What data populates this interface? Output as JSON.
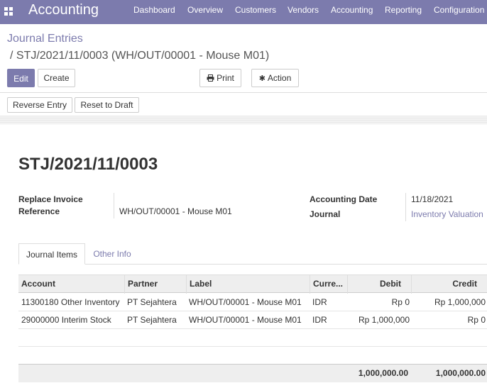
{
  "app": {
    "name": "Accounting"
  },
  "nav": {
    "dashboard": "Dashboard",
    "overview": "Overview",
    "customers": "Customers",
    "vendors": "Vendors",
    "accounting": "Accounting",
    "reporting": "Reporting",
    "configuration": "Configuration"
  },
  "breadcrumb": {
    "parent": "Journal Entries",
    "current": "/ STJ/2021/11/0003 (WH/OUT/00001 - Mouse M01)"
  },
  "toolbar": {
    "edit": "Edit",
    "create": "Create",
    "print": "Print",
    "action": "Action",
    "reverse": "Reverse Entry",
    "reset": "Reset to Draft"
  },
  "record": {
    "title": "STJ/2021/11/0003",
    "replace_invoice_label_1": "Replace Invoice",
    "replace_invoice_label_2": "Reference",
    "reference_value": "WH/OUT/00001 - Mouse M01",
    "accounting_date_label": "Accounting Date",
    "accounting_date_value": "11/18/2021",
    "journal_label": "Journal",
    "journal_value": "Inventory Valuation"
  },
  "tabs": {
    "journal_items": "Journal Items",
    "other_info": "Other Info"
  },
  "table": {
    "headers": {
      "account": "Account",
      "partner": "Partner",
      "label": "Label",
      "currency": "Curre...",
      "debit": "Debit",
      "credit": "Credit"
    },
    "rows": [
      {
        "account": "11300180 Other Inventory",
        "partner": "PT Sejahtera",
        "label": "WH/OUT/00001 - Mouse M01",
        "currency": "IDR",
        "debit": "Rp 0",
        "credit": "Rp 1,000,000"
      },
      {
        "account": "29000000 Interim Stock",
        "partner": "PT Sejahtera",
        "label": "WH/OUT/00001 - Mouse M01",
        "currency": "IDR",
        "debit": "Rp 1,000,000",
        "credit": "Rp 0"
      }
    ],
    "totals": {
      "debit": "1,000,000.00",
      "credit": "1,000,000.00"
    }
  },
  "colors": {
    "brand": "#7c7bad"
  }
}
